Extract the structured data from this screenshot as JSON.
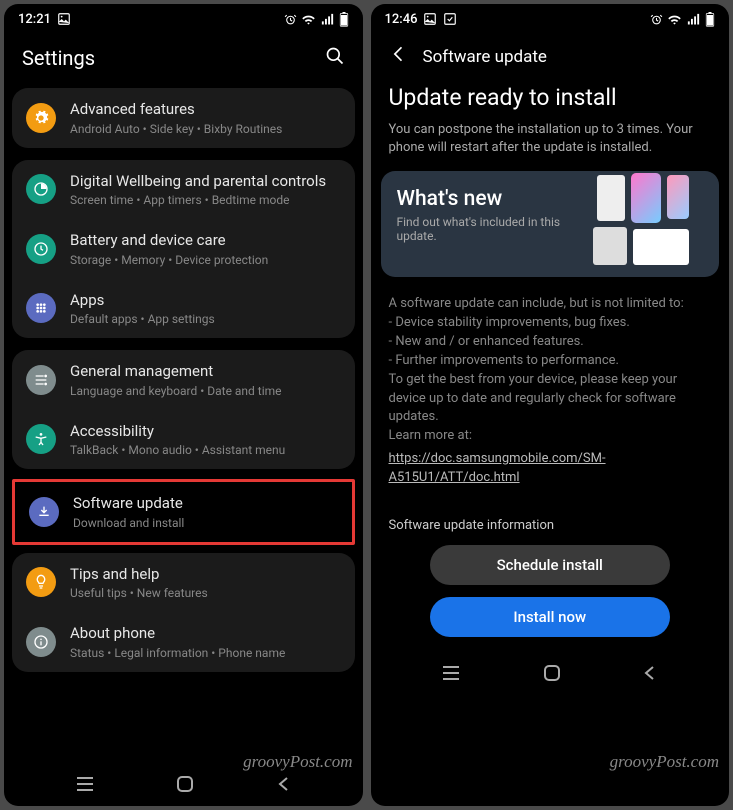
{
  "left": {
    "status": {
      "time": "12:21"
    },
    "header": {
      "title": "Settings"
    },
    "groups": [
      [
        {
          "icon": "gear",
          "color": "#f39c12",
          "title": "Advanced features",
          "sub": "Android Auto • Side key • Bixby Routines"
        }
      ],
      [
        {
          "icon": "wellbeing",
          "color": "#16a085",
          "title": "Digital Wellbeing and parental controls",
          "sub": "Screen time • App timers • Bedtime mode"
        },
        {
          "icon": "battery",
          "color": "#16a085",
          "title": "Battery and device care",
          "sub": "Storage • Memory • Device protection"
        },
        {
          "icon": "apps",
          "color": "#5b6bc0",
          "title": "Apps",
          "sub": "Default apps • App settings"
        }
      ],
      [
        {
          "icon": "general",
          "color": "#7f8c8d",
          "title": "General management",
          "sub": "Language and keyboard • Date and time"
        },
        {
          "icon": "accessibility",
          "color": "#16a085",
          "title": "Accessibility",
          "sub": "TalkBack • Mono audio • Assistant menu"
        },
        {
          "icon": "update",
          "color": "#5b6bc0",
          "title": "Software update",
          "sub": "Download and install",
          "highlight": true
        },
        {
          "icon": "tips",
          "color": "#f39c12",
          "title": "Tips and help",
          "sub": "Useful tips • New features"
        },
        {
          "icon": "about",
          "color": "#7f8c8d",
          "title": "About phone",
          "sub": "Status • Legal information • Phone name"
        }
      ]
    ]
  },
  "right": {
    "status": {
      "time": "12:46"
    },
    "header": {
      "title": "Software update"
    },
    "title": "Update ready to install",
    "desc": "You can postpone the installation up to 3 times. Your phone will restart after the update is installed.",
    "whatsnew": {
      "title": "What's new",
      "sub": "Find out what's included in this update."
    },
    "detail_lines": [
      "A software update can include, but is not limited to:",
      " - Device stability improvements, bug fixes.",
      " - New and / or enhanced features.",
      " - Further improvements to performance.",
      "To get the best from your device, please keep your device up to date and regularly check for software updates.",
      "",
      "Learn more at:"
    ],
    "link": "https://doc.samsungmobile.com/SM-A515U1/ATT/doc.html",
    "info_section": "Software update information",
    "buttons": {
      "schedule": "Schedule install",
      "install": "Install now"
    }
  },
  "watermark": "groovyPost.com"
}
